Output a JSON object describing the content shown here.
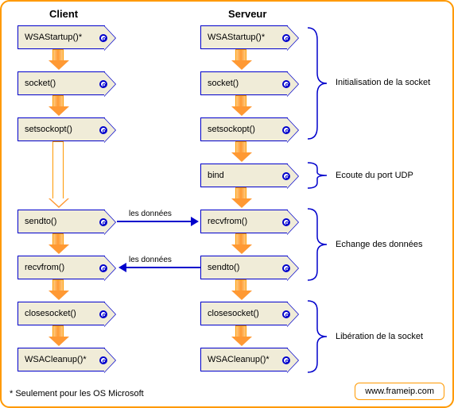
{
  "headers": {
    "client": "Client",
    "server": "Serveur"
  },
  "client_nodes": [
    "WSAStartup()*",
    "socket()",
    "setsockopt()",
    "sendto()",
    "recvfrom()",
    "closesocket()",
    "WSACleanup()*"
  ],
  "server_nodes": [
    "WSAStartup()*",
    "socket()",
    "setsockopt()",
    "bind",
    "recvfrom()",
    "sendto()",
    "closesocket()",
    "WSACleanup()*"
  ],
  "data_label": "les données",
  "sections": {
    "init": "Initialisation de la socket",
    "listen": "Ecoute du port UDP",
    "exchange": "Echange des données",
    "release": "Libération de la socket"
  },
  "footnote": "* Seulement pour les OS Microsoft",
  "url": "www.frameip.com",
  "chart_data": {
    "type": "flowchart",
    "columns": [
      "Client",
      "Serveur"
    ],
    "client_sequence": [
      "WSAStartup()*",
      "socket()",
      "setsockopt()",
      "sendto()",
      "recvfrom()",
      "closesocket()",
      "WSACleanup()*"
    ],
    "server_sequence": [
      "WSAStartup()*",
      "socket()",
      "setsockopt()",
      "bind",
      "recvfrom()",
      "sendto()",
      "closesocket()",
      "WSACleanup()*"
    ],
    "cross_edges": [
      {
        "from": "Client.sendto()",
        "to": "Serveur.recvfrom()",
        "label": "les données"
      },
      {
        "from": "Serveur.sendto()",
        "to": "Client.recvfrom()",
        "label": "les données"
      }
    ],
    "groups": [
      {
        "label": "Initialisation de la socket",
        "server_range": [
          "WSAStartup()*",
          "setsockopt()"
        ]
      },
      {
        "label": "Ecoute du port UDP",
        "server_range": [
          "bind",
          "bind"
        ]
      },
      {
        "label": "Echange des données",
        "server_range": [
          "recvfrom()",
          "sendto()"
        ]
      },
      {
        "label": "Libération de la socket",
        "server_range": [
          "closesocket()",
          "WSACleanup()*"
        ]
      }
    ],
    "footnote": "* Seulement pour les OS Microsoft",
    "source": "www.frameip.com"
  }
}
